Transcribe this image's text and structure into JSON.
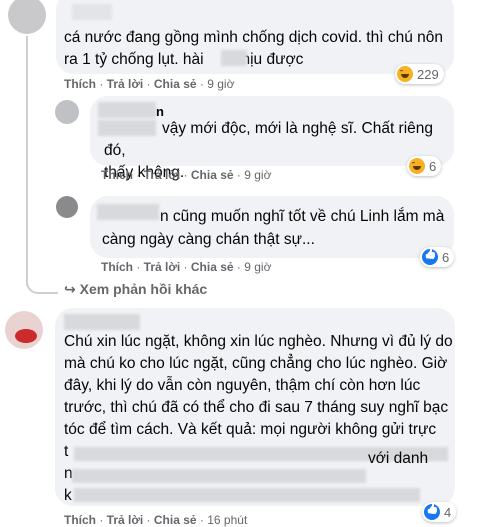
{
  "comments": [
    {
      "text": "cá nước đang gồng mình chống dịch covid. thì chú nôn\nra 1 tỷ chống lụt. hài       chịu được",
      "actions": {
        "like": "Thích",
        "reply": "Trả lời",
        "share": "Chia sẻ",
        "time": "9 giờ"
      },
      "reactions": {
        "icon": "haha",
        "count": "229"
      }
    },
    {
      "author_fragment": "n",
      "text": "vậy mới độc, mới là nghệ sĩ. Chất riêng đó,\nthấy không.",
      "actions": {
        "like": "Thích",
        "reply": "Trả lời",
        "share": "Chia sẻ",
        "time": "9 giờ"
      },
      "reactions": {
        "icon": "haha",
        "count": "6"
      }
    },
    {
      "text_line1": "n cũng muốn nghĩ tốt về chú Linh lắm mà",
      "text_line2": "càng ngày càng chán thật sự...",
      "actions": {
        "like": "Thích",
        "reply": "Trả lời",
        "share": "Chia sẻ",
        "time": "9 giờ"
      },
      "reactions": {
        "icon": "like",
        "count": "6"
      }
    },
    {
      "text": "Chú xin lúc ngặt, không xin lúc nghèo. Nhưng vì đủ lý do\nmà chú ko cho lúc ngặt, cũng chẳng cho lúc nghèo. Giờ\nđây, khi lý do vẫn còn nguyên, thậm chí còn hơn lúc\ntrước, thì chú đã có thể cho đi sau 7 tháng suy nghĩ bạc\ntóc để tìm cách. Và kết quả: mọi người không gửi trực",
      "fragment_t": "t",
      "fragment_voi_danh": "với danh",
      "fragment_n": "n",
      "fragment_k": "k",
      "actions": {
        "like": "Thích",
        "reply": "Trả lời",
        "share": "Chia sẻ",
        "time": "16 phút"
      },
      "reactions": {
        "icon": "like",
        "count": "4"
      }
    }
  ],
  "more_replies": {
    "arrow": "↪",
    "label": "Xem phản hồi khác"
  }
}
